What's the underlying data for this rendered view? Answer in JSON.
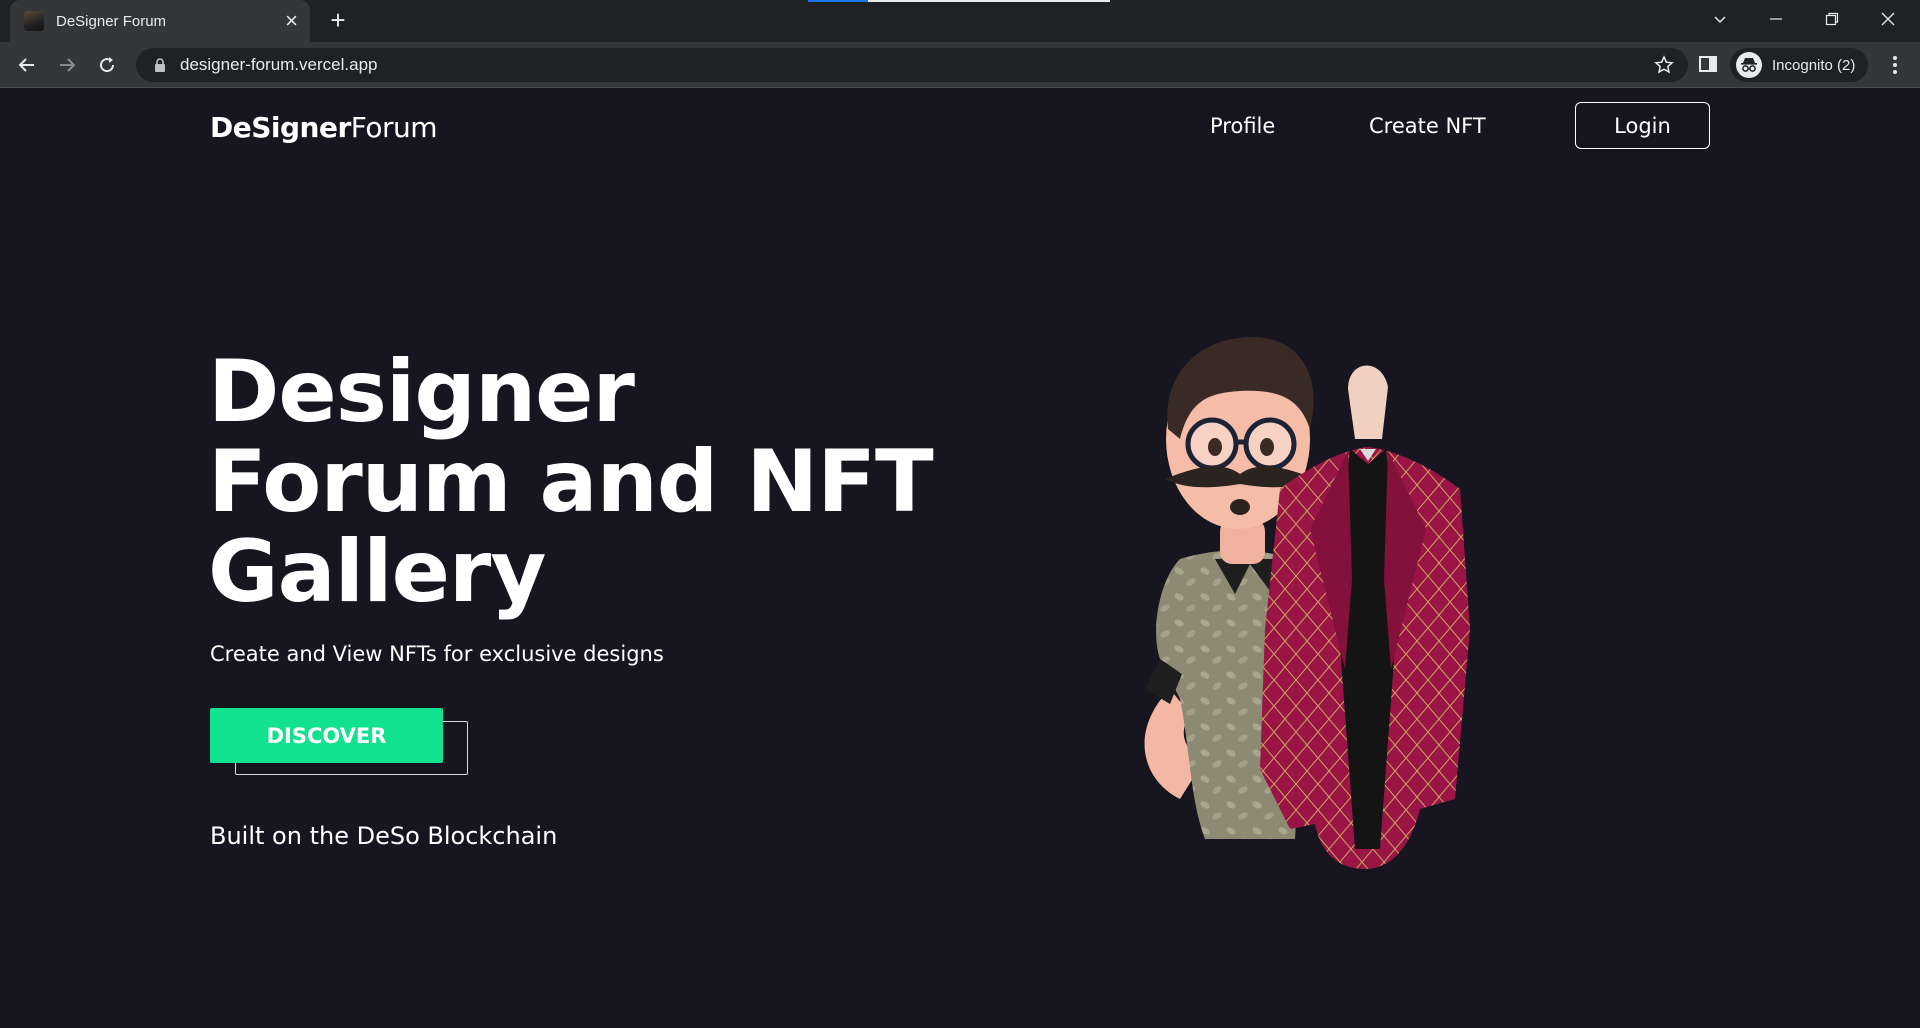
{
  "browser": {
    "tab_title": "DeSigner Forum",
    "new_tab_symbol": "+",
    "close_tab_symbol": "×",
    "url": "designer-forum.vercel.app",
    "profile_label": "Incognito (2)",
    "icons": [
      "back-icon",
      "forward-icon",
      "reload-icon",
      "lock-icon",
      "star-icon",
      "side-panel-icon",
      "incognito-icon",
      "more-icon",
      "tab-search-icon",
      "minimize-icon",
      "restore-icon",
      "close-icon"
    ]
  },
  "site": {
    "logo_bold": "DeSigner",
    "logo_light": "Forum",
    "nav": {
      "profile": "Profile",
      "create_nft": "Create NFT",
      "login": "Login"
    }
  },
  "hero": {
    "title_line1": "Designer",
    "title_line2": "Forum and NFT",
    "title_line3": "Gallery",
    "subtitle": "Create and View NFTs for exclusive designs",
    "cta": "DISCOVER",
    "built_on": "Built on the DeSo Blockchain",
    "accent_color": "#12e28e",
    "background_color": "#17151f"
  }
}
